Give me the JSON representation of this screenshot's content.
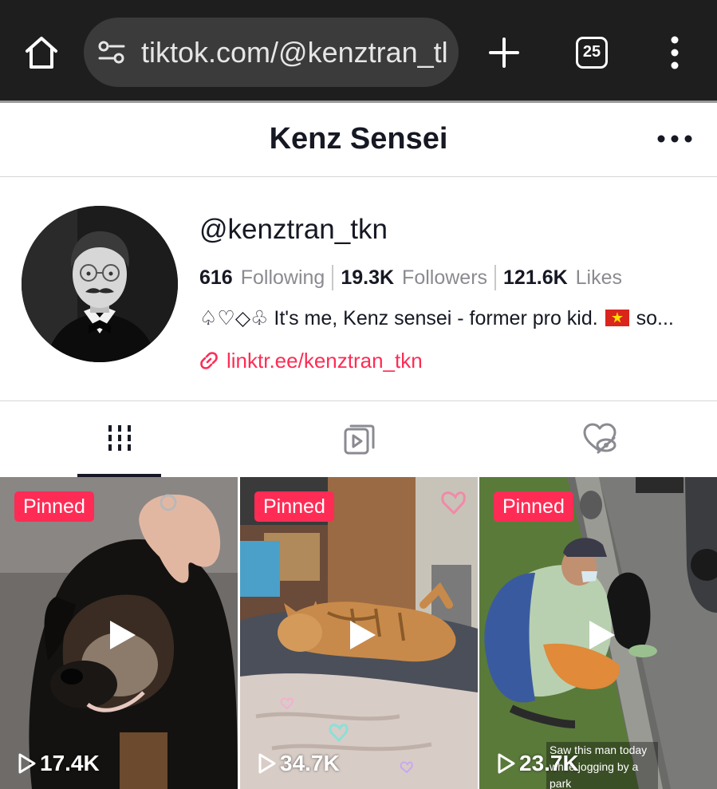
{
  "browser": {
    "url": "tiktok.com/@kenztran_tl",
    "tab_count": "25"
  },
  "header": {
    "title": "Kenz Sensei"
  },
  "profile": {
    "handle": "@kenztran_tkn",
    "stats": [
      {
        "value": "616",
        "label": "Following"
      },
      {
        "value": "19.3K",
        "label": "Followers"
      },
      {
        "value": "121.6K",
        "label": "Likes"
      }
    ],
    "bio_prefix": "♤♡◇♧ It's me, Kenz sensei - former pro kid.",
    "bio_suffix": "so...",
    "link": "linktr.ee/kenztran_tkn"
  },
  "tabs": [
    {
      "name": "videos",
      "active": true
    },
    {
      "name": "reposts",
      "active": false
    },
    {
      "name": "liked",
      "active": false
    }
  ],
  "videos": [
    {
      "badge": "Pinned",
      "views": "17.4K",
      "caption": ""
    },
    {
      "badge": "Pinned",
      "views": "34.7K",
      "caption": ""
    },
    {
      "badge": "Pinned",
      "views": "23.7K",
      "caption": "Saw this man today while jogging by a park"
    }
  ],
  "colors": {
    "accent": "#fe2c55",
    "chrome_bg": "#1e1e1e",
    "text": "#161823",
    "muted": "#8a8b91"
  }
}
